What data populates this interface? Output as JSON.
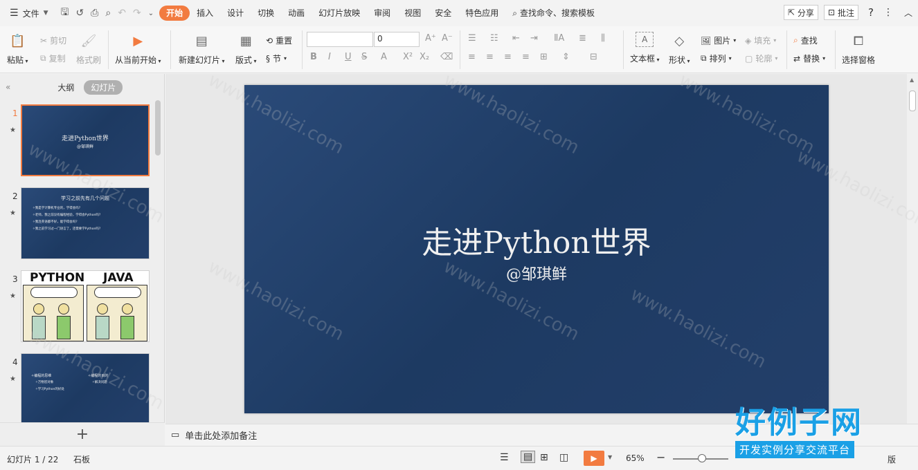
{
  "menu": {
    "file": "文件",
    "tabs": [
      "开始",
      "插入",
      "设计",
      "切换",
      "动画",
      "幻灯片放映",
      "审阅",
      "视图",
      "安全",
      "特色应用"
    ],
    "active_tab": "开始",
    "search": "查找命令、搜索模板",
    "share": "分享",
    "comment": "批注"
  },
  "ribbon": {
    "paste": "粘贴",
    "cut": "剪切",
    "copy": "复制",
    "format_painter": "格式刷",
    "from_current": "从当前开始",
    "new_slide": "新建幻灯片",
    "layout": "版式",
    "reset": "重置",
    "section": "节",
    "font_size": "0",
    "text_box": "文本框",
    "shape": "形状",
    "picture": "图片",
    "fill": "填充",
    "arrange": "排列",
    "outline": "轮廓",
    "find": "查找",
    "replace": "替换",
    "selection_pane": "选择窗格"
  },
  "panel": {
    "tab_outline": "大纲",
    "tab_slides": "幻灯片",
    "slides": [
      {
        "num": "1",
        "title": "走进Python世界",
        "sub": "@邹琪鲜"
      },
      {
        "num": "2",
        "title": "学习之前先有几个问题",
        "lines": [
          "✧我是学计算机专业的，学得会吗?",
          "✧老师，我之前没有编程经验，学得会Python吗?",
          "✧我连英语都不好，能学得会吗?",
          "✧我之前学习过一门语言了，还需要学Python吗?"
        ]
      },
      {
        "num": "3",
        "left_title": "PYTHON",
        "right_title": "JAVA"
      },
      {
        "num": "4",
        "col1": [
          "✧编程的思维",
          "✧万物皆对象",
          "✧学习Python的好处"
        ],
        "col2": [
          "✧编程的目的",
          "✧解决问题"
        ]
      }
    ]
  },
  "slide": {
    "title": "走进Python世界",
    "subtitle": "@邹琪鲜"
  },
  "notes": "单击此处添加备注",
  "status": {
    "slide_info": "幻灯片 1 / 22",
    "theme": "石板",
    "zoom": "65%",
    "right_fragment": "版"
  },
  "watermark": "www.haolizi.com",
  "brand": {
    "name": "好例子网",
    "slogan": "开发实例分享交流平台"
  }
}
